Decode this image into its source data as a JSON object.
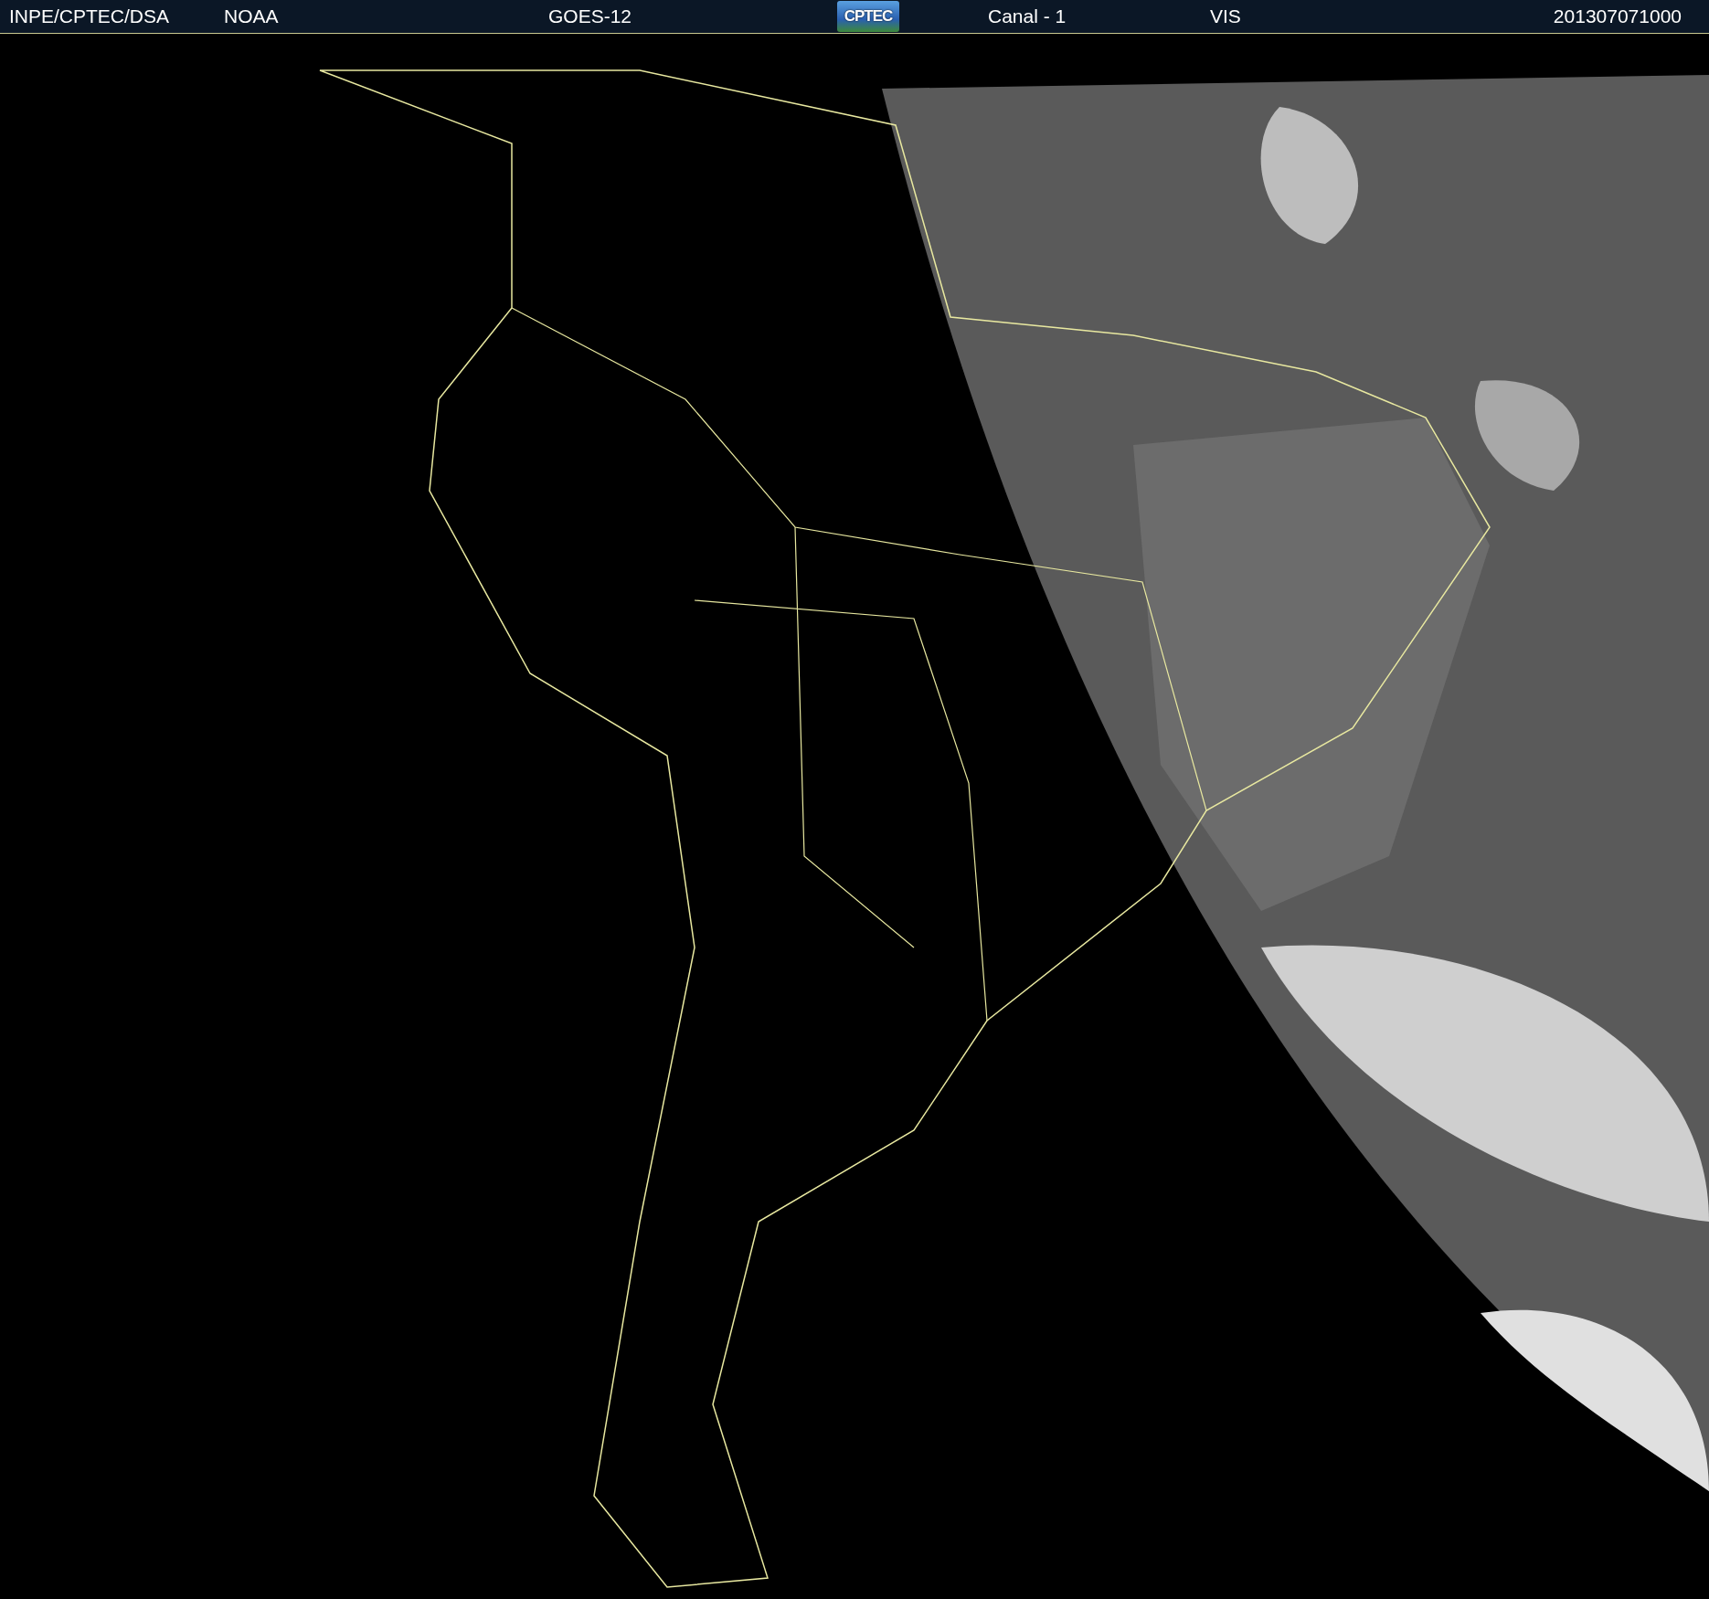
{
  "header": {
    "items": [
      {
        "text": "INPE/CPTEC/DSA",
        "kind": "text"
      },
      {
        "text": "NOAA",
        "kind": "text"
      },
      {
        "text": "GOES-12",
        "kind": "text"
      },
      {
        "text": "CPTEC",
        "kind": "logo"
      },
      {
        "text": "Canal - 1",
        "kind": "text"
      },
      {
        "text": "VIS",
        "kind": "text"
      },
      {
        "text": "201307071000",
        "kind": "text"
      }
    ]
  }
}
